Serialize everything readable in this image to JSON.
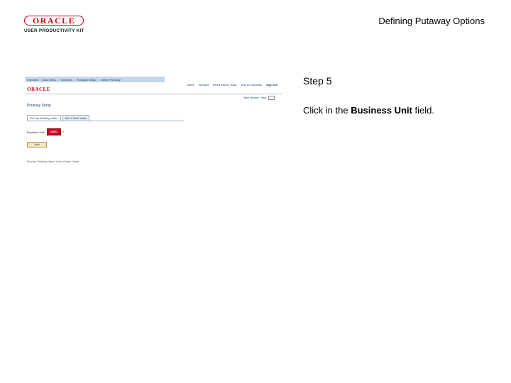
{
  "logo": {
    "wordmark": "ORACLE",
    "product": "USER PRODUCTIVITY KIT"
  },
  "slide": {
    "title": "Defining Putaway Options",
    "step": "Step 5",
    "instruction_prefix": "Click in the ",
    "instruction_bold": "Business Unit",
    "instruction_suffix": " field."
  },
  "screenshot": {
    "nav": [
      "Favorites",
      "Main Menu",
      "Inventory",
      "Putaway Setup",
      "Define Putaway"
    ],
    "top_links": [
      "Home",
      "Worklist",
      "Performance Trace",
      "Add to Favorites",
      "Sign out"
    ],
    "brand": "ORACLE",
    "sub_links": [
      "New Window",
      "Help"
    ],
    "page_title": "Putaway Setup",
    "tabs": [
      "Find an Existing Value",
      "Add a New Value"
    ],
    "field_label": "Business Unit:",
    "field_value": "US001",
    "add_button": "Add",
    "search_links": "Find an Existing Value | Add a New Value"
  }
}
